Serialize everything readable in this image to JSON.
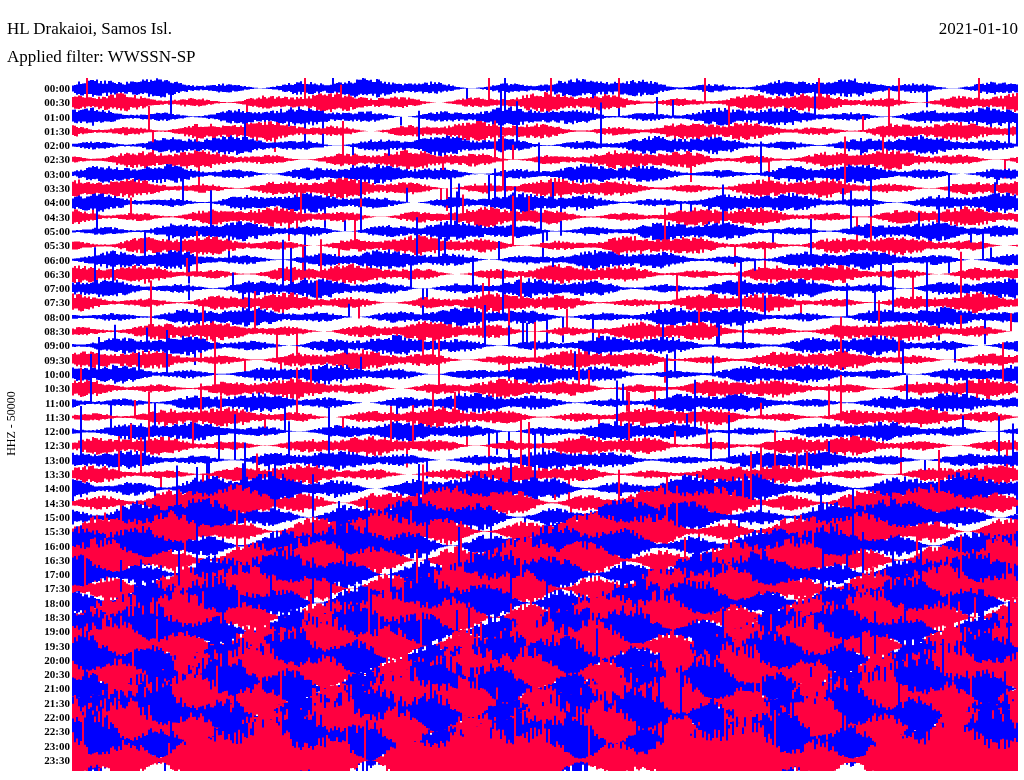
{
  "header": {
    "station": "HL Drakaioi, Samos Isl.",
    "filter": "Applied filter: WWSSN-SP",
    "date": "2021-01-10"
  },
  "axis_label": "HHZ - 50000",
  "traces": [
    {
      "time": "00:00"
    },
    {
      "time": "00:30"
    },
    {
      "time": "01:00"
    },
    {
      "time": "01:30"
    },
    {
      "time": "02:00"
    },
    {
      "time": "02:30"
    },
    {
      "time": "03:00"
    },
    {
      "time": "03:30"
    },
    {
      "time": "04:00"
    },
    {
      "time": "04:30"
    },
    {
      "time": "05:00"
    },
    {
      "time": "05:30"
    },
    {
      "time": "06:00"
    },
    {
      "time": "06:30"
    },
    {
      "time": "07:00"
    },
    {
      "time": "07:30"
    },
    {
      "time": "08:00"
    },
    {
      "time": "08:30"
    },
    {
      "time": "09:00"
    },
    {
      "time": "09:30"
    },
    {
      "time": "10:00"
    },
    {
      "time": "10:30"
    },
    {
      "time": "11:00"
    },
    {
      "time": "11:30"
    },
    {
      "time": "12:00"
    },
    {
      "time": "12:30"
    },
    {
      "time": "13:00"
    },
    {
      "time": "13:30"
    },
    {
      "time": "14:00"
    },
    {
      "time": "14:30"
    },
    {
      "time": "15:00"
    },
    {
      "time": "15:30"
    },
    {
      "time": "16:00"
    },
    {
      "time": "16:30"
    },
    {
      "time": "17:00"
    },
    {
      "time": "17:30"
    },
    {
      "time": "18:00"
    },
    {
      "time": "18:30"
    },
    {
      "time": "19:00"
    },
    {
      "time": "19:30"
    },
    {
      "time": "20:00"
    },
    {
      "time": "20:30"
    },
    {
      "time": "21:00"
    },
    {
      "time": "21:30"
    },
    {
      "time": "22:00"
    },
    {
      "time": "22:30"
    },
    {
      "time": "23:00"
    },
    {
      "time": "23:30"
    }
  ]
}
